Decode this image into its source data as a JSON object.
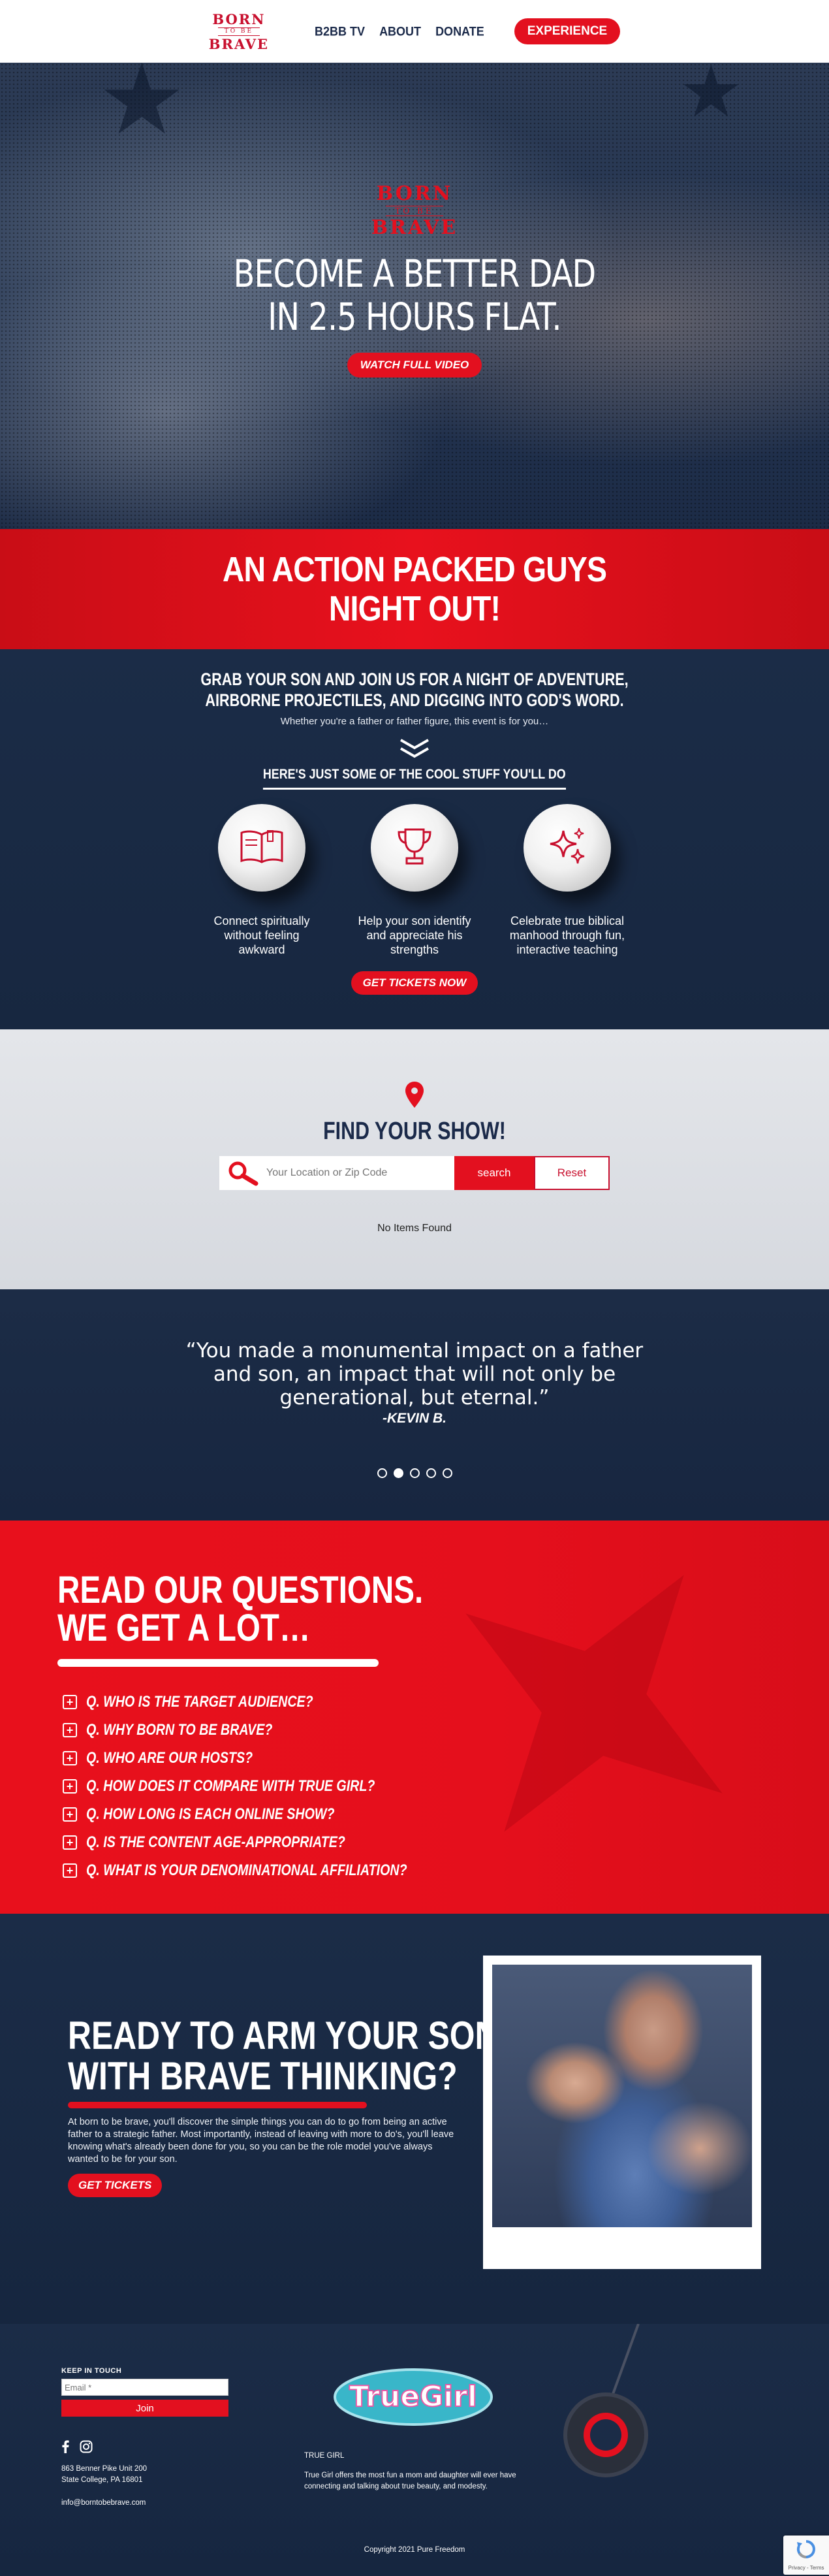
{
  "nav": {
    "logo": {
      "line1": "BORN",
      "line2": "TO BE",
      "line3": "BRAVE"
    },
    "links": [
      "B2BB TV",
      "ABOUT",
      "DONATE"
    ],
    "cta": "EXPERIENCE"
  },
  "hero": {
    "logo": {
      "line1": "BORN",
      "line2": "TO BE",
      "line3": "BRAVE"
    },
    "headline_line1": "BECOME A BETTER DAD",
    "headline_line2": "IN 2.5 HOURS FLAT.",
    "button": "WATCH FULL VIDEO"
  },
  "band": {
    "line1": "AN ACTION PACKED GUYS",
    "line2": "NIGHT OUT!"
  },
  "intro": {
    "lead_line1": "GRAB YOUR SON AND JOIN US FOR A NIGHT OF ADVENTURE,",
    "lead_line2": "AIRBORNE PROJECTILES, AND DIGGING INTO GOD'S WORD.",
    "sub": "Whether you're a father or father figure, this event is for you…",
    "cool_heading": "HERE'S JUST SOME OF THE COOL STUFF YOU'LL DO",
    "features": [
      {
        "icon": "bible-icon",
        "text": "Connect spiritually without feeling awkward"
      },
      {
        "icon": "trophy-icon",
        "text": "Help your son identify and appreciate his strengths"
      },
      {
        "icon": "sparkles-icon",
        "text": "Celebrate true biblical manhood through fun, interactive teaching"
      }
    ],
    "button": "GET TICKETS NOW"
  },
  "find": {
    "title": "FIND YOUR SHOW!",
    "placeholder": "Your Location or Zip Code",
    "search_label": "search",
    "reset_label": "Reset",
    "empty": "No Items Found"
  },
  "testimonial": {
    "quote": "“You made a monumental impact on a father and son, an impact that will not only be generational, but eternal.”",
    "author": "-KEVIN B.",
    "slides": 5,
    "active": 2
  },
  "faq": {
    "title_line1": "READ OUR QUESTIONS.",
    "title_line2": "WE GET A LOT…",
    "items": [
      "Q. WHO IS THE TARGET AUDIENCE?",
      "Q. WHY BORN TO BE BRAVE?",
      "Q. WHO ARE OUR HOSTS?",
      "Q. HOW DOES IT COMPARE WITH TRUE GIRL?",
      "Q. HOW LONG IS EACH ONLINE SHOW?",
      "Q. IS THE CONTENT AGE-APPROPRIATE?",
      "Q. WHAT IS YOUR DENOMINATIONAL AFFILIATION?"
    ]
  },
  "arm": {
    "title_line1": "READY TO ARM YOUR SON",
    "title_line2": "WITH BRAVE THINKING?",
    "body": "At born to be brave, you'll discover the simple things you can do to go from being an active father to a strategic father. Most importantly, instead of leaving with more to do's, you'll leave knowing what's already been done for you, so you can be the role model you've always wanted to be for your son.",
    "button": "GET TICKETS"
  },
  "footer": {
    "keep_in_touch": "KEEP IN TOUCH",
    "email_placeholder": "Email *",
    "join": "Join",
    "address_line1": "863 Benner Pike Unit 200",
    "address_line2": "State College, PA 16801",
    "email": "info@borntobebrave.com",
    "truegirl_logo": "TrueGirl",
    "truegirl_label": "TRUE GIRL",
    "truegirl_desc": "True Girl offers the most fun a mom and daughter will ever have connecting and talking about true beauty, and modesty.",
    "copyright": "Copyright 2021 Pure Freedom",
    "recaptcha": "Privacy - Terms"
  },
  "colors": {
    "red": "#e3101f",
    "navy": "#1b2c47",
    "light": "#e0e2e7"
  }
}
